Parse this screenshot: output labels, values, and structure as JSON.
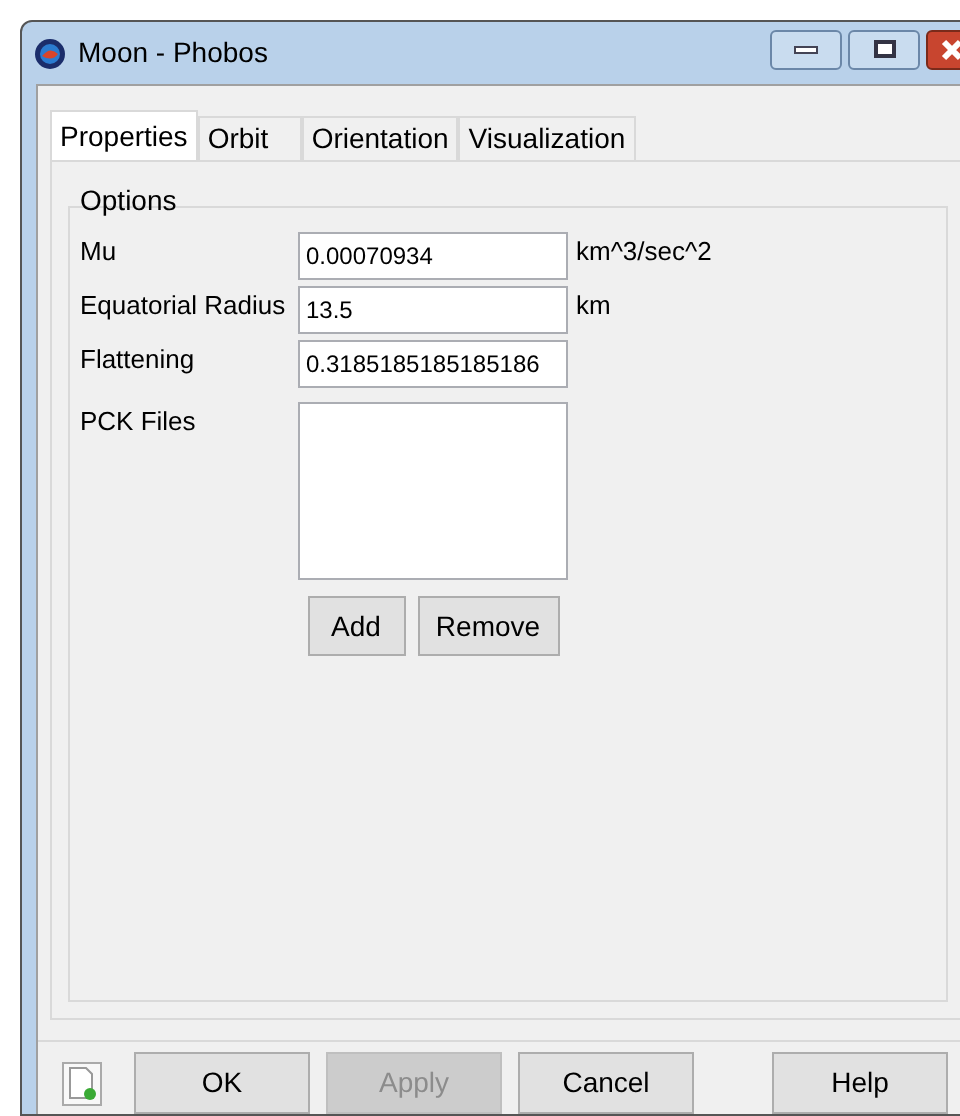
{
  "window": {
    "title": "Moon - Phobos"
  },
  "tabs": [
    {
      "label": "Properties",
      "selected": true
    },
    {
      "label": "Orbit",
      "selected": false
    },
    {
      "label": "Orientation",
      "selected": false
    },
    {
      "label": "Visualization",
      "selected": false
    }
  ],
  "group": {
    "title": "Options"
  },
  "fields": [
    {
      "label": "Mu",
      "value": "0.00070934",
      "unit": "km^3/sec^2"
    },
    {
      "label": "Equatorial Radius",
      "value": "13.5",
      "unit": "km"
    },
    {
      "label": "Flattening",
      "value": "0.3185185185185186"
    }
  ],
  "pck": {
    "label": "PCK Files",
    "buttons": [
      "Add",
      "Remove"
    ]
  },
  "buttons": [
    {
      "label": "OK",
      "disabled": false
    },
    {
      "label": "Apply",
      "disabled": true
    },
    {
      "label": "Cancel",
      "disabled": false
    },
    {
      "label": "Help",
      "disabled": false
    }
  ]
}
